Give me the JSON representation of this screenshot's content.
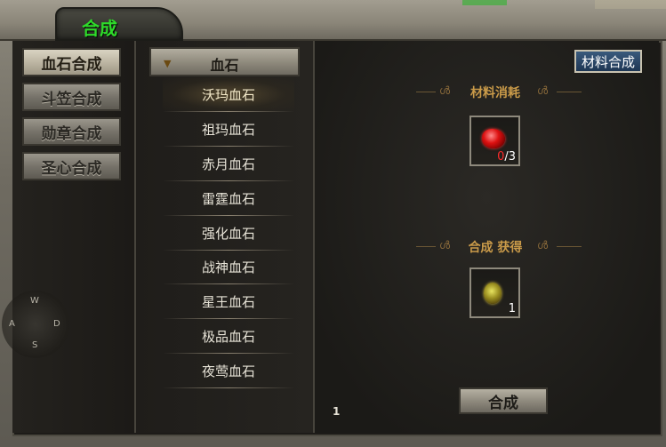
{
  "window": {
    "title": "合成"
  },
  "categories": [
    {
      "label": "血石合成",
      "active": true
    },
    {
      "label": "斗笠合成",
      "active": false
    },
    {
      "label": "勋章合成",
      "active": false
    },
    {
      "label": "圣心合成",
      "active": false
    }
  ],
  "dropdown": {
    "selected": "血石"
  },
  "items": [
    {
      "label": "沃玛血石",
      "selected": true
    },
    {
      "label": "祖玛血石"
    },
    {
      "label": "赤月血石"
    },
    {
      "label": "雷霆血石"
    },
    {
      "label": "强化血石"
    },
    {
      "label": "战神血石"
    },
    {
      "label": "星王血石"
    },
    {
      "label": "极品血石"
    },
    {
      "label": "夜莺血石"
    }
  ],
  "material_button": "材料合成",
  "materials": {
    "heading": "材料消耗",
    "have": "0",
    "need": "/3"
  },
  "result": {
    "heading": "合成 获得",
    "count": "1"
  },
  "compose_button": "合成",
  "page_number": "1",
  "joystick": {
    "up": "W",
    "left": "A",
    "right": "D",
    "down": "S"
  },
  "colors": {
    "title": "#2edb2a",
    "section_heading": "#c99a49",
    "shortfall": "#ff2a2a"
  }
}
